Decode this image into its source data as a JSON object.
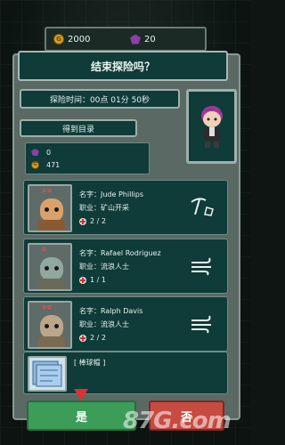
{
  "currency": {
    "gold": "2000",
    "gems": "20"
  },
  "dialog": {
    "title": "结束探险吗？",
    "time_label": "探险时间：00点 01分 50秒",
    "list_header": "得到目录"
  },
  "resources": {
    "gems": "0",
    "gold": "471"
  },
  "crew": [
    {
      "name": "名字：Jude Phillips",
      "job": "职业：矿山开采",
      "hp": "2 / 2",
      "job_icon": "pickaxe-icon"
    },
    {
      "name": "名字：Rafael Rodriguez",
      "job": "职业：流浪人士",
      "hp": "1 / 1",
      "job_icon": "wind-icon"
    },
    {
      "name": "名字：Ralph Davis",
      "job": "职业：流浪人士",
      "hp": "2 / 2",
      "job_icon": "wind-icon"
    }
  ],
  "item": {
    "name": "[ 棒球帽 ]"
  },
  "buttons": {
    "yes": "是",
    "no": "否"
  },
  "watermark": "87G.com",
  "colors": {
    "panel": "#0f3b38",
    "yes": "#3b9d58",
    "no": "#c64b40",
    "gold": "#d8a21f",
    "gem": "#8b3fa8"
  }
}
